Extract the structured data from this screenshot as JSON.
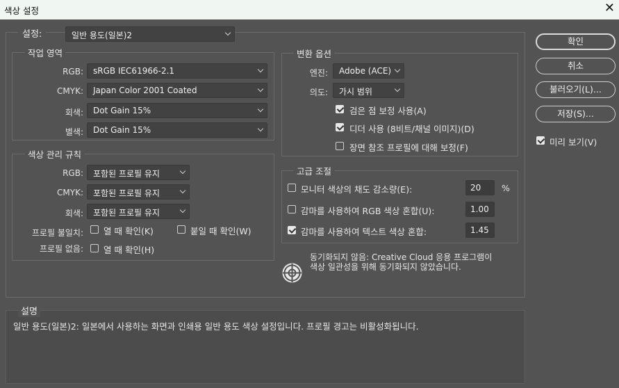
{
  "window": {
    "title": "색상 설정",
    "close_glyph": "✕"
  },
  "settings": {
    "label": "설정:",
    "value": "일반 용도(일본)2"
  },
  "working_spaces": {
    "legend": "작업 영역",
    "rows": [
      {
        "label": "RGB:",
        "value": "sRGB IEC61966-2.1"
      },
      {
        "label": "CMYK:",
        "value": "Japan Color 2001 Coated"
      },
      {
        "label": "회색:",
        "value": "Dot Gain 15%"
      },
      {
        "label": "별색:",
        "value": "Dot Gain 15%"
      }
    ]
  },
  "color_management": {
    "legend": "색상 관리 규칙",
    "rows": [
      {
        "label": "RGB:",
        "value": "포함된 프로필 유지"
      },
      {
        "label": "CMYK:",
        "value": "포함된 프로필 유지"
      },
      {
        "label": "회색:",
        "value": "포함된 프로필 유지"
      }
    ],
    "mismatch": {
      "label": "프로필 불일치:",
      "open_label": "열 때 확인(K)",
      "open_checked": false,
      "paste_label": "붙일 때 확인(W)",
      "paste_checked": false
    },
    "missing": {
      "label": "프로필 없음:",
      "open_label": "열 때 확인(H)",
      "open_checked": false
    }
  },
  "conversion": {
    "legend": "변환 옵션",
    "engine": {
      "label": "엔진:",
      "value": "Adobe (ACE)"
    },
    "intent": {
      "label": "의도:",
      "value": "가시 범위"
    },
    "options": [
      {
        "label": "검은 점 보정 사용(A)",
        "checked": true
      },
      {
        "label": "디더 사용 (8비트/채널 이미지)(D)",
        "checked": true
      },
      {
        "label": "장면 참조 프로필에 대해 보정(F)",
        "checked": false
      }
    ]
  },
  "advanced": {
    "legend": "고급 조절",
    "rows": [
      {
        "label": "모니터 색상의 채도 감소량(E):",
        "value": "20",
        "unit": "%",
        "checked": false
      },
      {
        "label": "감마를 사용하여 RGB 색상 혼합(U):",
        "value": "1.00",
        "unit": "",
        "checked": false
      },
      {
        "label": "감마를 사용하여 텍스트 색상 혼합:",
        "value": "1.45",
        "unit": "",
        "checked": true
      }
    ]
  },
  "sync": {
    "line1": "동기화되지 않음: Creative Cloud 응용 프로그램이",
    "line2": "색상 일관성을 위해 동기화되지 않았습니다."
  },
  "description": {
    "legend": "설명",
    "text": "일반 용도(일본)2: 일본에서 사용하는 화면과 인쇄용 일반 용도 색상 설정입니다. 프로필 경고는 비활성화됩니다."
  },
  "buttons": {
    "ok": "확인",
    "cancel": "취소",
    "load": "불러오기(L)...",
    "save": "저장(S)..."
  },
  "preview": {
    "label": "미리 보기(V)",
    "checked": true
  }
}
